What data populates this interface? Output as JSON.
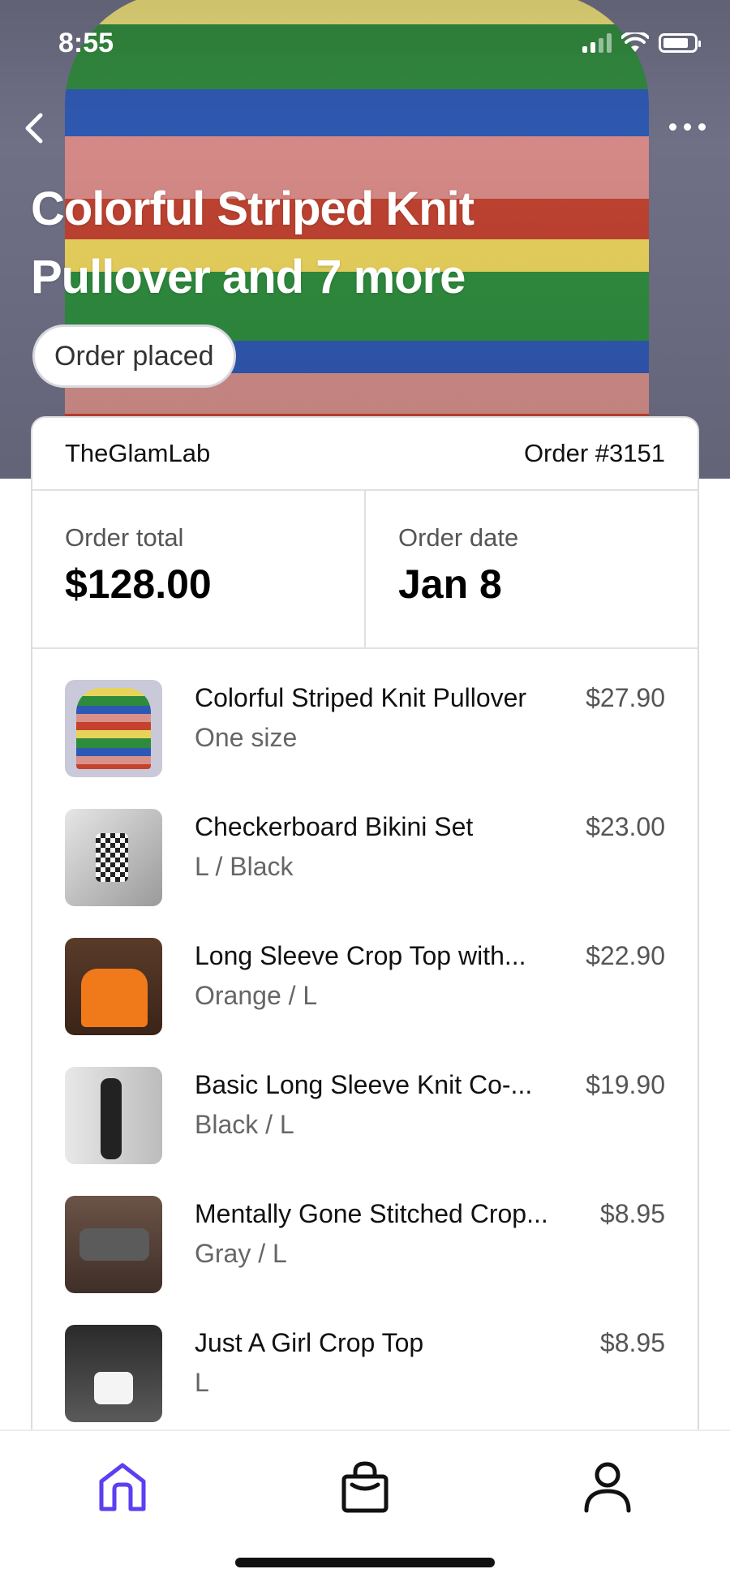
{
  "status_bar": {
    "time": "8:55"
  },
  "header": {
    "title": "Colorful Striped Knit Pullover and 7 more",
    "status": "Order placed"
  },
  "order": {
    "shop": "TheGlamLab",
    "number": "Order #3151",
    "total_label": "Order total",
    "total_value": "$128.00",
    "date_label": "Order date",
    "date_value": "Jan 8"
  },
  "items": [
    {
      "name": "Colorful Striped Knit Pullover",
      "price": "$27.90",
      "variant": "One size"
    },
    {
      "name": "Checkerboard Bikini Set",
      "price": "$23.00",
      "variant": "L / Black"
    },
    {
      "name": "Long Sleeve Crop Top with...",
      "price": "$22.90",
      "variant": "Orange / L"
    },
    {
      "name": "Basic Long Sleeve Knit Co-...",
      "price": "$19.90",
      "variant": "Black / L"
    },
    {
      "name": "Mentally Gone Stitched Crop...",
      "price": "$8.95",
      "variant": "Gray / L"
    },
    {
      "name": "Just A Girl Crop Top",
      "price": "$8.95",
      "variant": "L"
    }
  ],
  "tabbar": {
    "active_tab": "home",
    "accent_color": "#5b3ff0"
  },
  "icons": [
    "chevron-left-icon",
    "more-icon",
    "home-icon",
    "shopping-bag-icon",
    "profile-icon"
  ]
}
